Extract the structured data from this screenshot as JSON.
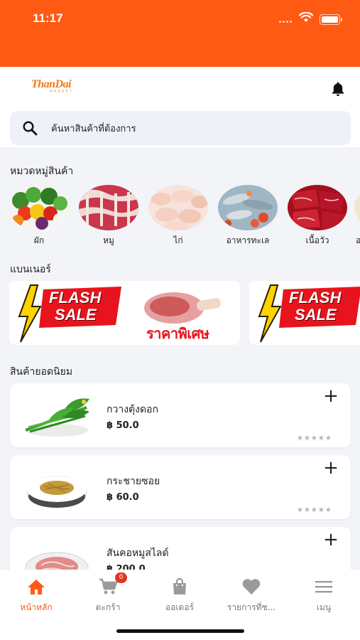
{
  "status_bar": {
    "time": "11:17"
  },
  "header": {
    "logo_main": "ThanDai",
    "logo_sub": "MARKET",
    "search_placeholder": "ค้นหาสินค้าที่ต้องการ"
  },
  "categories": {
    "title": "หมวดหมู่สินค้า",
    "items": [
      {
        "label": "ผัก"
      },
      {
        "label": "หมู"
      },
      {
        "label": "ไก่"
      },
      {
        "label": "อาหารทะเล"
      },
      {
        "label": "เนื้อวัว"
      },
      {
        "label": "อ"
      }
    ]
  },
  "banners": {
    "title": "แบนเนอร์",
    "items": [
      {
        "flash_line1": "FLASH",
        "flash_line2": "SALE",
        "promo_text": "ราคาพิเศษ"
      },
      {
        "flash_line1": "FLASH",
        "flash_line2": "SALE"
      }
    ]
  },
  "popular": {
    "title": "สินค้ายอดนิยม",
    "products": [
      {
        "name": "กวางตุ้งดอก",
        "price": "฿ 50.0",
        "add_label": "+",
        "rating_display": "★★★★★"
      },
      {
        "name": "กระชายซอย",
        "price": "฿ 60.0",
        "add_label": "+",
        "rating_display": "★★★★★"
      },
      {
        "name": "สันคอหมูสไลด์",
        "price": "฿ 200.0",
        "add_label": "+"
      }
    ]
  },
  "bottom_nav": {
    "items": [
      {
        "label": "หน้าหลัก",
        "icon": "home-icon",
        "active": true
      },
      {
        "label": "ตะกร้า",
        "icon": "cart-icon",
        "badge": "0"
      },
      {
        "label": "ออเดอร์",
        "icon": "bag-icon"
      },
      {
        "label": "รายการที่ช...",
        "icon": "heart-icon"
      },
      {
        "label": "เมนู",
        "icon": "menu-icon"
      }
    ]
  },
  "colors": {
    "brand": "#ff5a14",
    "badge": "#e63324",
    "flash_red": "#e8141d",
    "flash_yellow": "#ffd200"
  }
}
